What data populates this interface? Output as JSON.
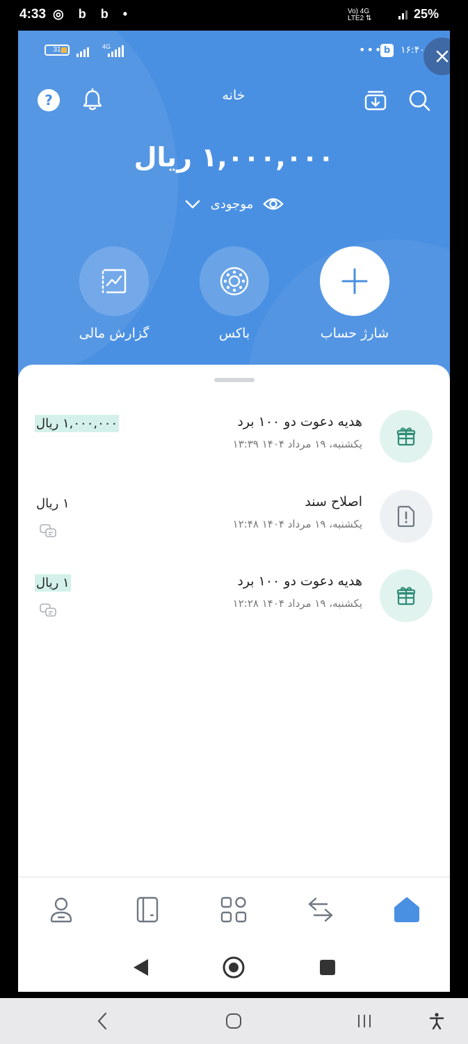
{
  "outer_status": {
    "time": "4:33",
    "left_icons": "◎ b b •",
    "net_line1": "Vo) 4G",
    "net_line2": "LTE2 ⇅",
    "battery": "25%"
  },
  "inner_status": {
    "battery_level": "31",
    "network": "4G",
    "dots": "•••",
    "app_badge": "b",
    "time": "۱۶:۴۰"
  },
  "header": {
    "title": "خانه"
  },
  "balance": {
    "amount": "۱,۰۰۰,۰۰۰ ریال",
    "label": "موجودی"
  },
  "actions": [
    {
      "label": "شارژ حساب",
      "icon": "plus-icon"
    },
    {
      "label": "باکس",
      "icon": "box-icon"
    },
    {
      "label": "گزارش مالی",
      "icon": "chart-icon"
    }
  ],
  "transactions": [
    {
      "title": "هدیه دعوت دو ۱۰۰ برد",
      "date": "یکشنبه، ۱۹ مرداد ۱۴۰۴ ۱۳:۳۹",
      "amount": "۱,۰۰۰,۰۰۰ ریال",
      "icon": "gift-icon",
      "highlight": true
    },
    {
      "title": "اصلاح سند",
      "date": "یکشنبه، ۱۹ مرداد ۱۴۰۴ ۱۲:۴۸",
      "amount": "۱ ریال",
      "icon": "document-alert-icon",
      "highlight": false
    },
    {
      "title": "هدیه دعوت دو ۱۰۰ برد",
      "date": "یکشنبه، ۱۹ مرداد ۱۴۰۴ ۱۲:۲۸",
      "amount": "۱ ریال",
      "icon": "gift-icon",
      "highlight": true
    }
  ],
  "colors": {
    "primary": "#4a90e2",
    "accent_green": "#2e8b74",
    "highlight": "#d3f1ea",
    "icon_gray": "#6f7782"
  }
}
